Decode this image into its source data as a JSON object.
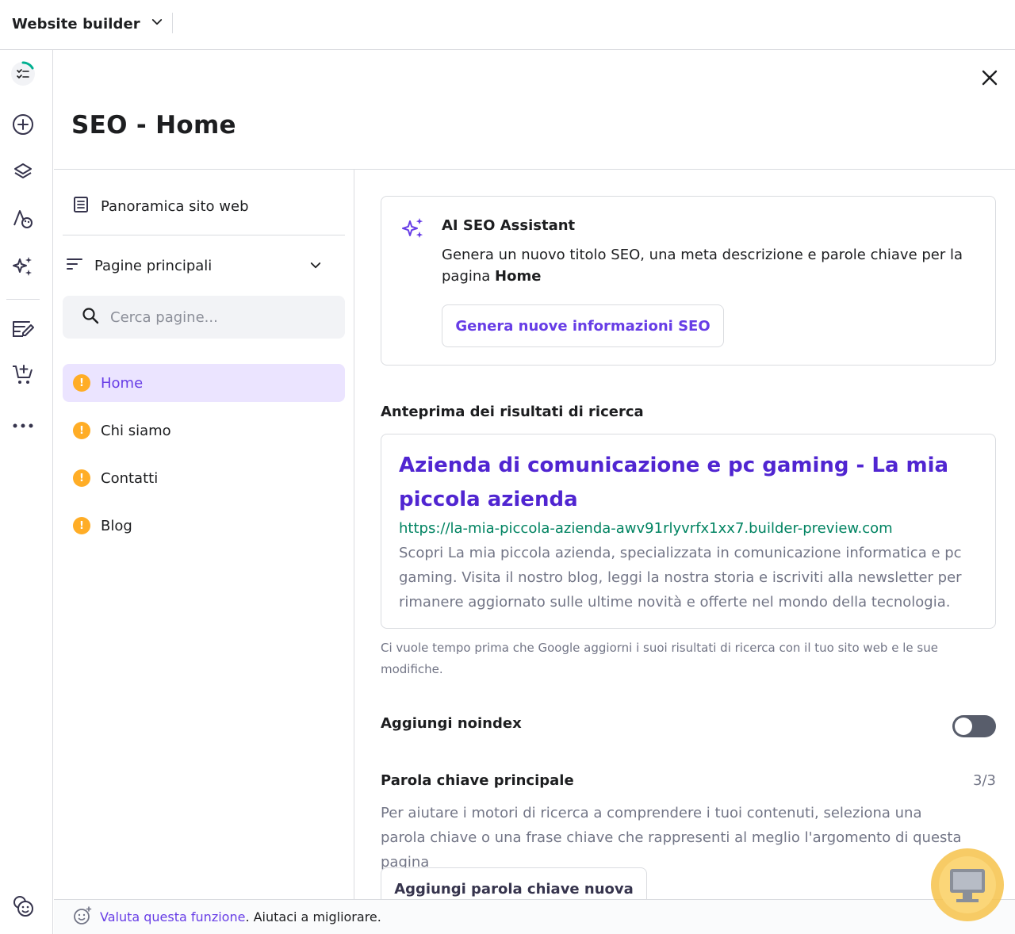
{
  "topbar": {
    "app_title": "Website builder",
    "app_icon": "chevron-down-icon"
  },
  "rail": {
    "items": [
      {
        "icon": "checklist-progress-icon"
      },
      {
        "icon": "add-circle-icon"
      },
      {
        "icon": "layers-icon"
      },
      {
        "icon": "styles-palette-icon"
      },
      {
        "icon": "ai-sparkle-icon"
      },
      {
        "icon": "blog-edit-icon"
      },
      {
        "icon": "store-cart-icon"
      },
      {
        "icon": "more-icon"
      },
      {
        "icon": "cookie-icon"
      }
    ]
  },
  "panel": {
    "title": "SEO - Home"
  },
  "pagenav": {
    "overview_label": "Panoramica sito web",
    "group_label": "Pagine principali",
    "search_placeholder": "Cerca pagine...",
    "pages": [
      {
        "label": "Home",
        "active": true
      },
      {
        "label": "Chi siamo",
        "active": false
      },
      {
        "label": "Contatti",
        "active": false
      },
      {
        "label": "Blog",
        "active": false
      }
    ],
    "warning_glyph": "!"
  },
  "ai_assistant": {
    "title": "AI SEO Assistant",
    "desc_prefix": "Genera un nuovo titolo SEO, una meta descrizione e parole chiave per la pagina ",
    "desc_page": "Home",
    "button_label": "Genera nuove informazioni SEO"
  },
  "preview": {
    "section_title": "Anteprima dei risultati di ricerca",
    "title": "Azienda di comunicazione e pc gaming - La mia piccola azienda",
    "url": "https://la-mia-piccola-azienda-awv91rlyvrfx1xx7.builder-preview.com",
    "description": "Scopri La mia piccola azienda, specializzata in comunicazione informatica e pc gaming. Visita il nostro blog, leggi la nostra storia e iscriviti alla newsletter per rimanere aggiornato sulle ultime novità e offerte nel mondo della tecnologia.",
    "note": "Ci vuole tempo prima che Google aggiorni i suoi risultati di ricerca con il tuo sito web e le sue modifiche."
  },
  "noindex": {
    "label": "Aggiungi noindex",
    "enabled": false
  },
  "keyword": {
    "title": "Parola chiave principale",
    "count": "3/3",
    "description": "Per aiutare i motori di ricerca a comprendere i tuoi contenuti, seleziona una parola chiave o una frase chiave che rappresenti al meglio l'argomento di questa pagina",
    "add_button": "Aggiungi parola chiave nuova"
  },
  "feedback": {
    "link_label": "Valuta questa funzione",
    "suffix": ". Aiutaci a migliorare."
  },
  "colors": {
    "accent": "#673de6",
    "warning": "#ffad26",
    "url_green": "#008361"
  }
}
